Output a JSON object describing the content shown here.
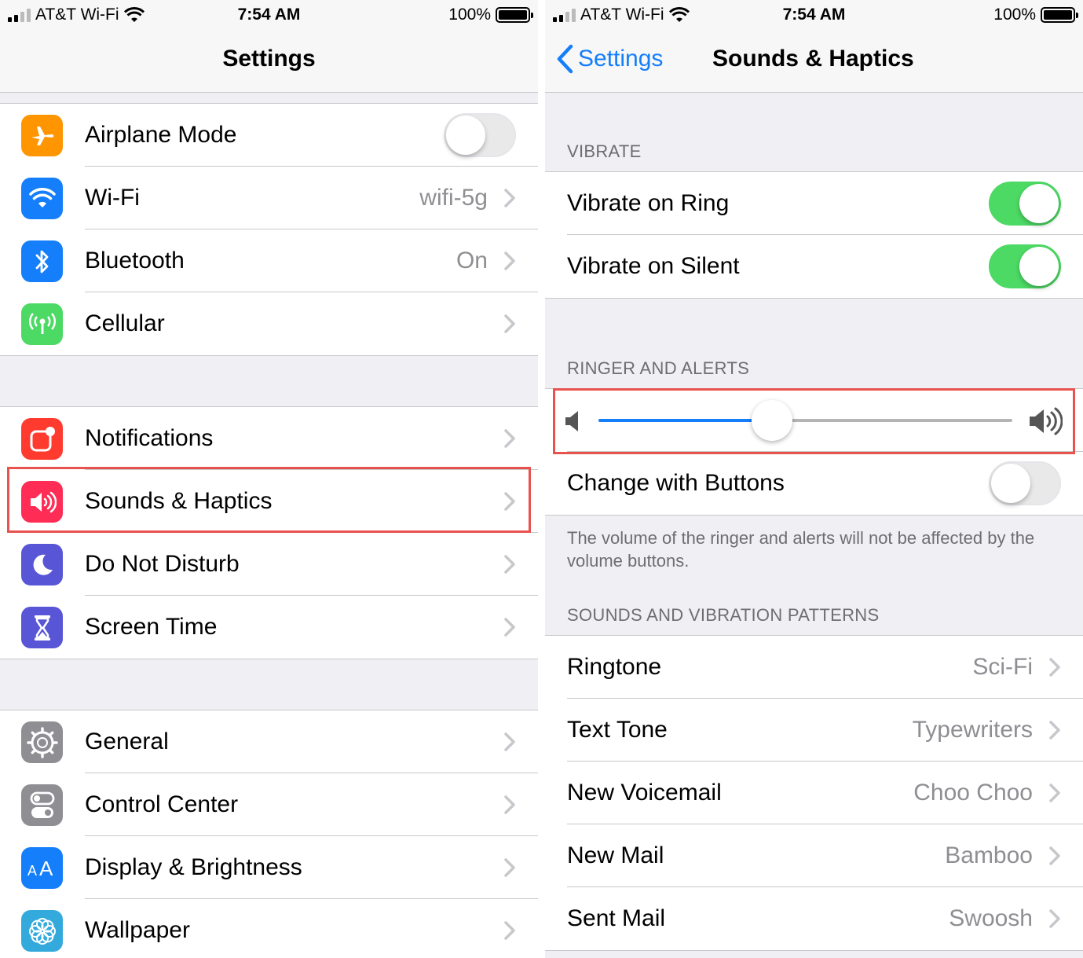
{
  "status": {
    "carrier": "AT&T Wi-Fi",
    "time": "7:54 AM",
    "battery": "100%"
  },
  "settings": {
    "title": "Settings",
    "groups": [
      [
        {
          "label": "Airplane Mode",
          "icon": "airplane-icon",
          "color": "#ff9500",
          "toggle": false
        },
        {
          "label": "Wi-Fi",
          "icon": "wifi-icon",
          "color": "#147efb",
          "value": "wifi-5g"
        },
        {
          "label": "Bluetooth",
          "icon": "bluetooth-icon",
          "color": "#147efb",
          "value": "On"
        },
        {
          "label": "Cellular",
          "icon": "cellular-icon",
          "color": "#4cd964"
        }
      ],
      [
        {
          "label": "Notifications",
          "icon": "notifications-icon",
          "color": "#ff3b30"
        },
        {
          "label": "Sounds & Haptics",
          "icon": "speaker-icon",
          "color": "#ff2d55"
        },
        {
          "label": "Do Not Disturb",
          "icon": "moon-icon",
          "color": "#5856d6"
        },
        {
          "label": "Screen Time",
          "icon": "hourglass-icon",
          "color": "#5856d6"
        }
      ],
      [
        {
          "label": "General",
          "icon": "gear-icon",
          "color": "#8e8e93"
        },
        {
          "label": "Control Center",
          "icon": "switches-icon",
          "color": "#8e8e93"
        },
        {
          "label": "Display & Brightness",
          "icon": "text-size-icon",
          "color": "#147efb"
        },
        {
          "label": "Wallpaper",
          "icon": "flower-icon",
          "color": "#34aadc"
        }
      ]
    ]
  },
  "sounds": {
    "back_label": "Settings",
    "title": "Sounds & Haptics",
    "vibrate_header": "VIBRATE",
    "vibrate_on_ring": {
      "label": "Vibrate on Ring",
      "on": true
    },
    "vibrate_on_silent": {
      "label": "Vibrate on Silent",
      "on": true
    },
    "ringer_header": "RINGER AND ALERTS",
    "ringer_volume": 0.42,
    "change_with_buttons": {
      "label": "Change with Buttons",
      "on": false
    },
    "ringer_footer": "The volume of the ringer and alerts will not be affected by the volume buttons.",
    "patterns_header": "SOUNDS AND VIBRATION PATTERNS",
    "patterns": [
      {
        "label": "Ringtone",
        "value": "Sci-Fi"
      },
      {
        "label": "Text Tone",
        "value": "Typewriters"
      },
      {
        "label": "New Voicemail",
        "value": "Choo Choo"
      },
      {
        "label": "New Mail",
        "value": "Bamboo"
      },
      {
        "label": "Sent Mail",
        "value": "Swoosh"
      }
    ]
  },
  "colors": {
    "accent": "#147efb",
    "toggle_on": "#4cd964",
    "highlight": "#e8534f"
  }
}
